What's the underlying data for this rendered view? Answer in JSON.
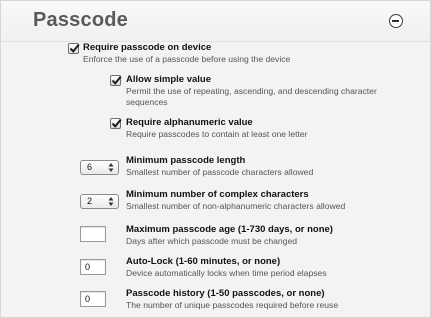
{
  "section": {
    "title": "Passcode"
  },
  "require_passcode": {
    "label": "Require passcode on device",
    "description": "Enforce the use of a passcode before using the device",
    "checked": true
  },
  "allow_simple": {
    "label": "Allow simple value",
    "description_line1": "Permit the use of repeating, ascending, and descending character",
    "description_line2": "sequences",
    "checked": true
  },
  "require_alphanumeric": {
    "label": "Require alphanumeric value",
    "description": "Require passcodes to contain at least one letter",
    "checked": true
  },
  "min_length": {
    "value": "6",
    "label": "Minimum passcode length",
    "description": "Smallest number of passcode characters allowed"
  },
  "min_complex": {
    "value": "2",
    "label": "Minimum number of complex characters",
    "description": "Smallest number of non-alphanumeric characters allowed"
  },
  "max_age": {
    "value": "",
    "label": "Maximum passcode age (1-730 days, or none)",
    "description": "Days after which passcode must be changed"
  },
  "auto_lock": {
    "value": "0",
    "label": "Auto-Lock (1-60 minutes, or none)",
    "description": "Device automatically locks when time period elapses"
  },
  "history": {
    "value": "0",
    "label": "Passcode history (1-50 passcodes, or none)",
    "description": "The number of unique passcodes required before reuse"
  }
}
